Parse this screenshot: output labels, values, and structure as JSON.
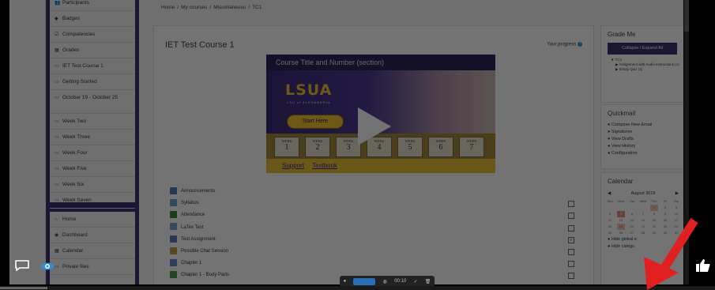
{
  "breadcrumb": [
    "Home",
    "/",
    "My courses",
    "/",
    "Miscellaneous",
    "/",
    "TC1"
  ],
  "nav": {
    "items": [
      {
        "icon": "users-icon",
        "glyph": "👥",
        "label": "Participants"
      },
      {
        "icon": "badge-icon",
        "glyph": "◆",
        "label": "Badges"
      },
      {
        "icon": "check-icon",
        "glyph": "☑",
        "label": "Competencies"
      },
      {
        "icon": "table-icon",
        "glyph": "▦",
        "label": "Grades"
      },
      {
        "icon": "folder-icon",
        "glyph": "▭",
        "label": "IET Test Course 1"
      },
      {
        "icon": "folder-icon",
        "glyph": "▭",
        "label": "Getting Started"
      },
      {
        "icon": "folder-icon",
        "glyph": "▭",
        "label": "October 19 - October 25"
      },
      {
        "icon": "folder-icon",
        "glyph": "▭",
        "label": "Week Two"
      },
      {
        "icon": "folder-icon",
        "glyph": "▭",
        "label": "Week Three"
      },
      {
        "icon": "folder-icon",
        "glyph": "▭",
        "label": "Week Four"
      },
      {
        "icon": "folder-icon",
        "glyph": "▭",
        "label": "Week Five"
      },
      {
        "icon": "folder-icon",
        "glyph": "▭",
        "label": "Week Six"
      },
      {
        "icon": "folder-icon",
        "glyph": "▭",
        "label": "Week Seven"
      }
    ],
    "items2": [
      {
        "icon": "home-icon",
        "glyph": "⌂",
        "label": "Home"
      },
      {
        "icon": "dashboard-icon",
        "glyph": "◉",
        "label": "Dashboard"
      },
      {
        "icon": "calendar-icon",
        "glyph": "▦",
        "label": "Calendar"
      },
      {
        "icon": "file-icon",
        "glyph": "▭",
        "label": "Private files"
      }
    ]
  },
  "course": {
    "title": "IET Test Course 1",
    "progress_label": "Your progress",
    "banner_title": "Course Title and Number (section)",
    "logo": "LSUA",
    "logo_sub": "LSU of ALEXANDRIA",
    "start_label": "Start Here",
    "week_word": "WEEK",
    "weeks": [
      "1",
      "2",
      "3",
      "4",
      "5",
      "6",
      "7"
    ],
    "links": [
      "Support",
      "Textbook"
    ]
  },
  "activities": [
    {
      "label": "Announcements",
      "color": "#4a7ab8",
      "checkbox": false,
      "checked": false
    },
    {
      "label": "Syllabus",
      "color": "#6aa0d8",
      "checkbox": true,
      "checked": false
    },
    {
      "label": "Attendance",
      "color": "#3a8a3a",
      "checkbox": true,
      "checked": false
    },
    {
      "label": "LaTex Test",
      "color": "#7aa0c8",
      "checkbox": true,
      "checked": false
    },
    {
      "label": "Test Assignment",
      "color": "#5a7ab8",
      "checkbox": true,
      "checked": true
    },
    {
      "label": "Possible Chat Session",
      "color": "#c8a040",
      "checkbox": true,
      "checked": false
    },
    {
      "label": "Chapter 1",
      "color": "#5a8ac8",
      "checkbox": true,
      "checked": false
    },
    {
      "label": "Chapter 1 - Body Parts",
      "color": "#4a9a4a",
      "checkbox": true,
      "checked": false
    }
  ],
  "grade_me": {
    "title": "Grade Me",
    "collapse_label": "Collapse / Expand All",
    "tree": [
      "▼ TC1",
      "▶ Assignment with Audio Instructions (1)",
      "▶ Essay Quiz (1)"
    ]
  },
  "quickmail": {
    "title": "Quickmail",
    "items": [
      "Compose New Email",
      "Signatures",
      "View Drafts",
      "View History",
      "Configuration"
    ]
  },
  "calendar": {
    "title": "Calendar",
    "month": "August 2019",
    "days": [
      "Sun",
      "Mon",
      "Tue",
      "Wed",
      "Thu",
      "Fri",
      "Sat"
    ],
    "weeks": [
      [
        "",
        "",
        "",
        "",
        "1",
        "2",
        "3"
      ],
      [
        "4",
        "5",
        "6",
        "7",
        "8",
        "9",
        "10"
      ],
      [
        "11",
        "12",
        "13",
        "14",
        "15",
        "16",
        "17"
      ],
      [
        "18",
        "19",
        "20",
        "21",
        "22",
        "23",
        "24"
      ],
      [
        "25",
        "26",
        "27",
        "28",
        "29",
        "30",
        "31"
      ]
    ],
    "hide_global": "Hide global e",
    "hide_category": "Hide catego"
  },
  "player": {
    "time": "00:10"
  },
  "colors": {
    "brand": "#3f2f73",
    "gold": "#f4c430",
    "arrow": "#e02020"
  }
}
